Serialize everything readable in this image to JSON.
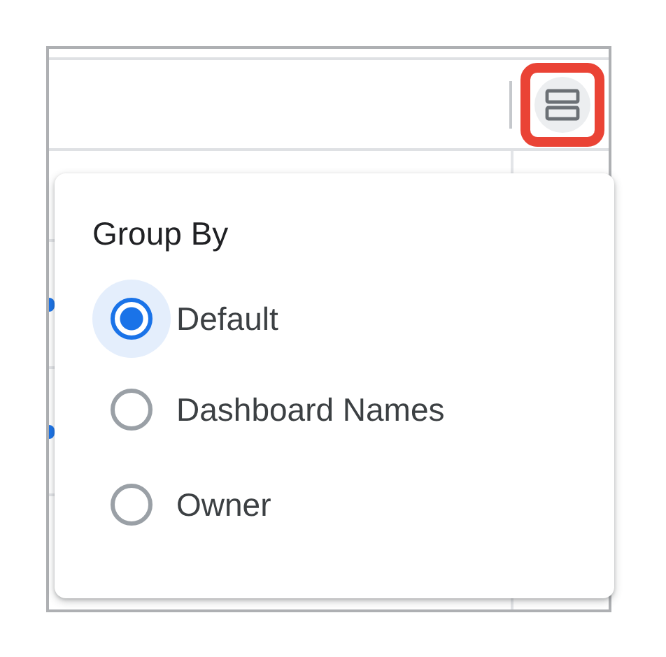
{
  "popup": {
    "title": "Group By",
    "options": [
      {
        "label": "Default",
        "selected": true
      },
      {
        "label": "Dashboard Names",
        "selected": false
      },
      {
        "label": "Owner",
        "selected": false
      }
    ]
  }
}
